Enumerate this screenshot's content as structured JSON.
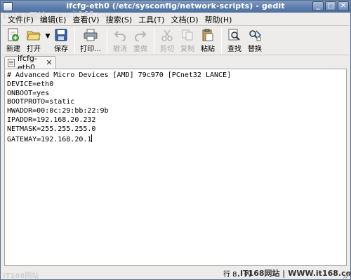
{
  "window": {
    "title": "ifcfg-eth0 (/etc/sysconfig/network-scripts) - gedit",
    "controls": [
      "_",
      "□",
      "✕"
    ]
  },
  "watermarks": {
    "top_left": "IT168网站",
    "top_left_url": "www.it168.com",
    "bottom_left": "IT168网站"
  },
  "menubar": {
    "items": [
      {
        "label": "文件(F)"
      },
      {
        "label": "编辑(E)"
      },
      {
        "label": "查看(V)"
      },
      {
        "label": "搜索(S)"
      },
      {
        "label": "工具(T)"
      },
      {
        "label": "文档(D)"
      },
      {
        "label": "帮助(H)"
      }
    ]
  },
  "toolbar": {
    "new_label": "新建",
    "open_label": "打开",
    "save_label": "保存",
    "print_label": "打印...",
    "undo_label": "撤消",
    "redo_label": "重做",
    "cut_label": "剪切",
    "copy_label": "复制",
    "paste_label": "粘贴",
    "find_label": "查找",
    "replace_label": "替换",
    "dropdown_arrow": "▼"
  },
  "tab": {
    "label": "ifcfg-eth0",
    "close": "✕"
  },
  "editor": {
    "lines": [
      "# Advanced Micro Devices [AMD] 79c970 [PCnet32 LANCE]",
      "DEVICE=eth0",
      "ONBOOT=yes",
      "BOOTPROTO=static",
      "HWADDR=00:0c:29:bb:22:9b",
      "IPADDR=192.168.20.232",
      "NETMASK=255.255.255.0",
      "GATEWAY=192.168.20.1"
    ]
  },
  "statusbar": {
    "position": "行 8，列",
    "site": "IT168网站 | WWW.it168.com"
  },
  "colors": {
    "titlebar": "#5b7cab",
    "window_bg": "#edeceb",
    "editor_bg": "#ffffff"
  }
}
